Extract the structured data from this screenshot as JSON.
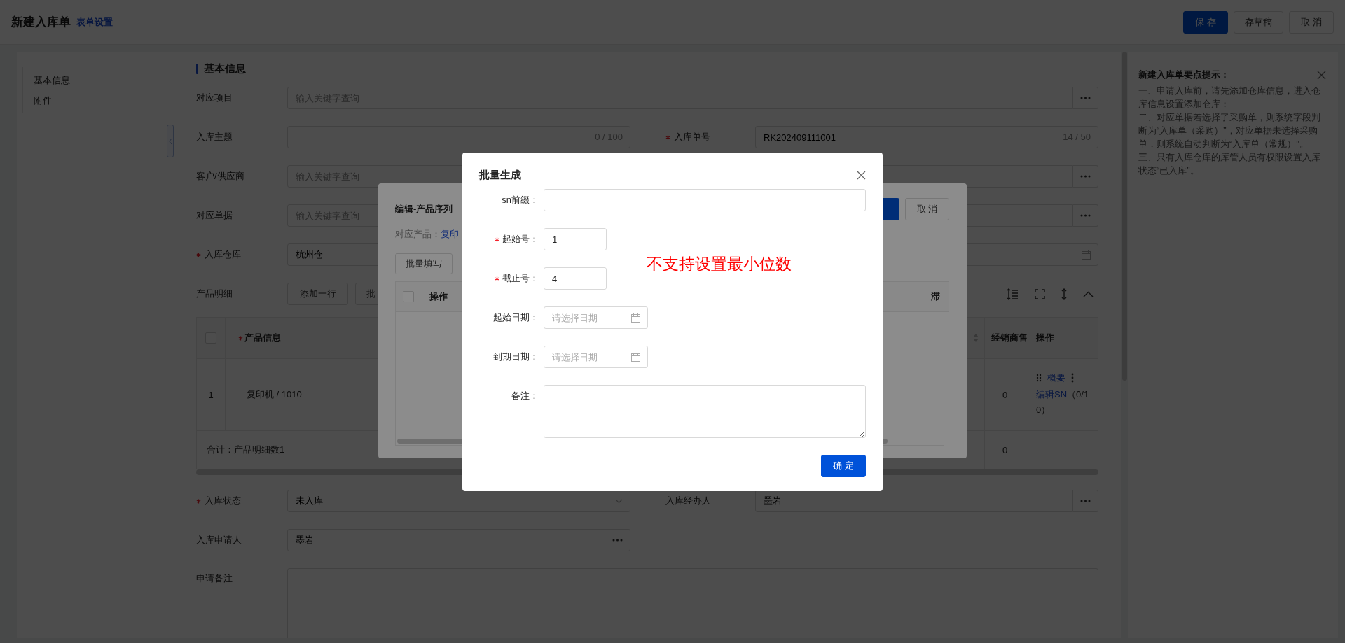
{
  "header": {
    "title": "新建入库单",
    "settings_link": "表单设置",
    "buttons": [
      {
        "label": "保 存",
        "kind": "primary"
      },
      {
        "label": "存草稿",
        "kind": "default"
      },
      {
        "label": "取 消",
        "kind": "default"
      }
    ]
  },
  "nav": {
    "items": [
      "基本信息",
      "附件"
    ]
  },
  "form": {
    "section_title": "基本信息",
    "rows_top": [
      {
        "fields": [
          {
            "label": "对应项目",
            "required": false,
            "wide": true,
            "kind": "lookup",
            "placeholder": "输入关键字查询"
          }
        ]
      },
      {
        "fields": [
          {
            "label": "入库主题",
            "required": false,
            "wide": false,
            "kind": "text",
            "counter": "0 / 100"
          },
          {
            "label": "入库单号",
            "required": true,
            "wide": false,
            "kind": "text",
            "value": "RK202409111001",
            "counter": "14 / 50"
          }
        ]
      },
      {
        "fields": [
          {
            "label": "客户/供应商",
            "required": false,
            "wide": true,
            "kind": "lookup",
            "placeholder": "输入关键字查询"
          }
        ]
      },
      {
        "fields": [
          {
            "label": "对应单据",
            "required": false,
            "wide": true,
            "kind": "lookup",
            "placeholder": "输入关键字查询"
          }
        ]
      },
      {
        "fields": [
          {
            "label": "入库仓库",
            "required": true,
            "wide": true,
            "kind": "date",
            "value": "杭州仓"
          }
        ]
      }
    ],
    "product_detail": {
      "label": "产品明细",
      "buttons": [
        "添加一行",
        "批"
      ],
      "table": {
        "select_all_checked": false,
        "product_column": {
          "label": "产品信息",
          "required": true
        },
        "sales_column": "经销商售",
        "action_column": "操作",
        "rows": [
          {
            "index": "1",
            "product": "复印机 / 1010",
            "sales": "0",
            "summary_link": "概要",
            "edit_link": "编辑SN",
            "sn_count": "（0/10）"
          }
        ],
        "total": {
          "label": "合计：产品明细数1",
          "sales": "0"
        }
      }
    },
    "rows_bottom": [
      {
        "fields": [
          {
            "label": "入库状态",
            "required": true,
            "wide": false,
            "kind": "select",
            "value": "未入库"
          },
          {
            "label": "入库经办人",
            "required": false,
            "wide": false,
            "kind": "lookup",
            "value": "墨岩"
          }
        ]
      },
      {
        "fields": [
          {
            "label": "入库申请人",
            "required": false,
            "wide": false,
            "kind": "lookup",
            "value": "墨岩"
          }
        ]
      },
      {
        "fields": [
          {
            "label": "申请备注",
            "required": false,
            "wide": true,
            "kind": "textarea"
          }
        ]
      }
    ]
  },
  "tips": {
    "title": "新建入库单要点提示：",
    "lines": [
      "一、申请入库前，请先添加仓库信息，进入仓库信息设置添加仓库；",
      "二、对应单据若选择了采购单，则系统字段判断为“入库单（采购）”，对应单据未选择采购单，则系统自动判断为“入库单（常规）”。",
      "三、只有入库仓库的库管人员有权限设置入库状态“已入库”。"
    ]
  },
  "serial_dialog": {
    "title": "编辑-产品序列",
    "product_label": "对应产品：",
    "product_value": "复印",
    "fill_button": "批量填写",
    "cancel_button": "取 消",
    "select_all_checked": false,
    "columns": [
      "操作",
      "滞"
    ]
  },
  "batch_dialog": {
    "title": "批量生成",
    "fields": [
      {
        "label": "sn前缀：",
        "required": false,
        "kind": "text"
      },
      {
        "label": "起始号：",
        "required": true,
        "kind": "number",
        "value": "1"
      },
      {
        "label": "截止号：",
        "required": true,
        "kind": "number",
        "value": "4"
      },
      {
        "label": "起始日期：",
        "required": false,
        "kind": "date",
        "placeholder": "请选择日期"
      },
      {
        "label": "到期日期：",
        "required": false,
        "kind": "date",
        "placeholder": "请选择日期"
      },
      {
        "label": "备注：",
        "required": false,
        "kind": "textarea"
      }
    ],
    "confirm_button": "确 定"
  },
  "annotation": "不支持设置最小位数"
}
